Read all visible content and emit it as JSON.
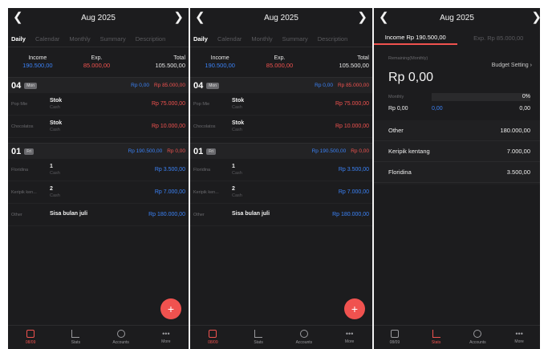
{
  "month": "Aug 2025",
  "tabs": [
    "Daily",
    "Calendar",
    "Monthly",
    "Summary",
    "Description"
  ],
  "summary": {
    "income_label": "Income",
    "income_value": "190.500,00",
    "exp_label": "Exp.",
    "exp_value": "85.000,00",
    "total_label": "Total",
    "total_value": "105.500,00"
  },
  "days": [
    {
      "num": "04",
      "tag": "Mon",
      "income": "Rp 0,00",
      "expense": "Rp 85.000,00",
      "rows": [
        {
          "category": "Pop Mie",
          "title": "Stok",
          "account": "Cash",
          "amount": "Rp 75.000,00",
          "type": "expense"
        },
        {
          "category": "Chocolatos",
          "title": "Stok",
          "account": "Cash",
          "amount": "Rp 10.000,00",
          "type": "expense"
        }
      ]
    },
    {
      "num": "01",
      "tag": "Fri",
      "income": "Rp 190.500,00",
      "expense": "Rp 0,00",
      "rows": [
        {
          "category": "Floridina",
          "title": "1",
          "account": "Cash",
          "amount": "Rp 3.500,00",
          "type": "income"
        },
        {
          "category": "Keripik ken...",
          "title": "2",
          "account": "Cash",
          "amount": "Rp 7.000,00",
          "type": "income"
        },
        {
          "category": "Other",
          "title": "Sisa bulan juli",
          "account": "",
          "amount": "Rp 180.000,00",
          "type": "income"
        }
      ]
    }
  ],
  "fab_icon": "+",
  "bottom_nav": [
    {
      "label": "08/09",
      "icon": "calendar-icon",
      "active": true
    },
    {
      "label": "Stats",
      "icon": "stats-icon",
      "active": false
    },
    {
      "label": "Accounts",
      "icon": "accounts-icon",
      "active": false
    },
    {
      "label": "More",
      "icon": "more-icon",
      "active": false
    }
  ],
  "stats": {
    "tab_income": "Income Rp 190.500,00",
    "tab_exp": "Exp. Rp 85.000,00",
    "remaining_label": "Remaining(Monthly)",
    "budget_setting": "Budget Setting",
    "remaining_value": "Rp 0,00",
    "monthly_label": "Monthly",
    "monthly_percent": "0%",
    "monthly_budget": "Rp 0,00",
    "monthly_used": "0,00",
    "monthly_remaining": "0,00",
    "categories": [
      {
        "name": "Other",
        "value": "180.000,00"
      },
      {
        "name": "Keripik kentang",
        "value": "7.000,00"
      },
      {
        "name": "Floridina",
        "value": "3.500,00"
      }
    ]
  },
  "colors": {
    "accent": "#f0524f",
    "income": "#3b82f6",
    "background": "#1c1c1e"
  }
}
